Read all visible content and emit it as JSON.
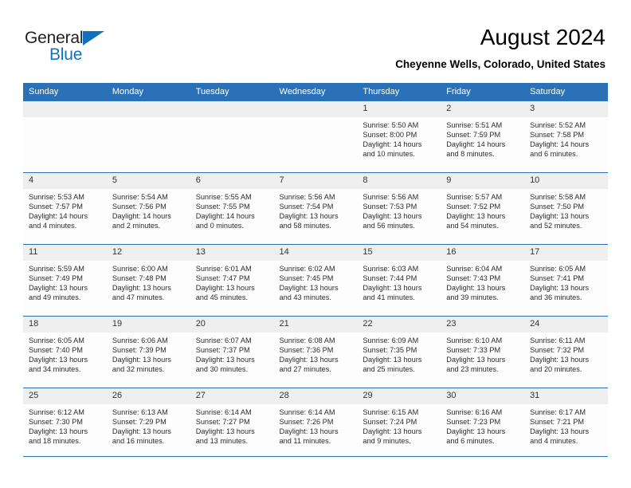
{
  "logo": {
    "top_text": "General",
    "bottom_text": "Blue",
    "triangle_color": "#1271bd"
  },
  "header": {
    "title": "August 2024",
    "subtitle": "Cheyenne Wells, Colorado, United States"
  },
  "theme": {
    "header_blue": "#2b71b8",
    "daynum_bg": "#efefef",
    "cell_bg": "#fdfdfd"
  },
  "calendar": {
    "weekday_headers": [
      "Sunday",
      "Monday",
      "Tuesday",
      "Wednesday",
      "Thursday",
      "Friday",
      "Saturday"
    ],
    "weeks": [
      [
        {
          "day": "",
          "lines": []
        },
        {
          "day": "",
          "lines": []
        },
        {
          "day": "",
          "lines": []
        },
        {
          "day": "",
          "lines": []
        },
        {
          "day": "1",
          "lines": [
            "Sunrise: 5:50 AM",
            "Sunset: 8:00 PM",
            "Daylight: 14 hours",
            "and 10 minutes."
          ]
        },
        {
          "day": "2",
          "lines": [
            "Sunrise: 5:51 AM",
            "Sunset: 7:59 PM",
            "Daylight: 14 hours",
            "and 8 minutes."
          ]
        },
        {
          "day": "3",
          "lines": [
            "Sunrise: 5:52 AM",
            "Sunset: 7:58 PM",
            "Daylight: 14 hours",
            "and 6 minutes."
          ]
        }
      ],
      [
        {
          "day": "4",
          "lines": [
            "Sunrise: 5:53 AM",
            "Sunset: 7:57 PM",
            "Daylight: 14 hours",
            "and 4 minutes."
          ]
        },
        {
          "day": "5",
          "lines": [
            "Sunrise: 5:54 AM",
            "Sunset: 7:56 PM",
            "Daylight: 14 hours",
            "and 2 minutes."
          ]
        },
        {
          "day": "6",
          "lines": [
            "Sunrise: 5:55 AM",
            "Sunset: 7:55 PM",
            "Daylight: 14 hours",
            "and 0 minutes."
          ]
        },
        {
          "day": "7",
          "lines": [
            "Sunrise: 5:56 AM",
            "Sunset: 7:54 PM",
            "Daylight: 13 hours",
            "and 58 minutes."
          ]
        },
        {
          "day": "8",
          "lines": [
            "Sunrise: 5:56 AM",
            "Sunset: 7:53 PM",
            "Daylight: 13 hours",
            "and 56 minutes."
          ]
        },
        {
          "day": "9",
          "lines": [
            "Sunrise: 5:57 AM",
            "Sunset: 7:52 PM",
            "Daylight: 13 hours",
            "and 54 minutes."
          ]
        },
        {
          "day": "10",
          "lines": [
            "Sunrise: 5:58 AM",
            "Sunset: 7:50 PM",
            "Daylight: 13 hours",
            "and 52 minutes."
          ]
        }
      ],
      [
        {
          "day": "11",
          "lines": [
            "Sunrise: 5:59 AM",
            "Sunset: 7:49 PM",
            "Daylight: 13 hours",
            "and 49 minutes."
          ]
        },
        {
          "day": "12",
          "lines": [
            "Sunrise: 6:00 AM",
            "Sunset: 7:48 PM",
            "Daylight: 13 hours",
            "and 47 minutes."
          ]
        },
        {
          "day": "13",
          "lines": [
            "Sunrise: 6:01 AM",
            "Sunset: 7:47 PM",
            "Daylight: 13 hours",
            "and 45 minutes."
          ]
        },
        {
          "day": "14",
          "lines": [
            "Sunrise: 6:02 AM",
            "Sunset: 7:45 PM",
            "Daylight: 13 hours",
            "and 43 minutes."
          ]
        },
        {
          "day": "15",
          "lines": [
            "Sunrise: 6:03 AM",
            "Sunset: 7:44 PM",
            "Daylight: 13 hours",
            "and 41 minutes."
          ]
        },
        {
          "day": "16",
          "lines": [
            "Sunrise: 6:04 AM",
            "Sunset: 7:43 PM",
            "Daylight: 13 hours",
            "and 39 minutes."
          ]
        },
        {
          "day": "17",
          "lines": [
            "Sunrise: 6:05 AM",
            "Sunset: 7:41 PM",
            "Daylight: 13 hours",
            "and 36 minutes."
          ]
        }
      ],
      [
        {
          "day": "18",
          "lines": [
            "Sunrise: 6:05 AM",
            "Sunset: 7:40 PM",
            "Daylight: 13 hours",
            "and 34 minutes."
          ]
        },
        {
          "day": "19",
          "lines": [
            "Sunrise: 6:06 AM",
            "Sunset: 7:39 PM",
            "Daylight: 13 hours",
            "and 32 minutes."
          ]
        },
        {
          "day": "20",
          "lines": [
            "Sunrise: 6:07 AM",
            "Sunset: 7:37 PM",
            "Daylight: 13 hours",
            "and 30 minutes."
          ]
        },
        {
          "day": "21",
          "lines": [
            "Sunrise: 6:08 AM",
            "Sunset: 7:36 PM",
            "Daylight: 13 hours",
            "and 27 minutes."
          ]
        },
        {
          "day": "22",
          "lines": [
            "Sunrise: 6:09 AM",
            "Sunset: 7:35 PM",
            "Daylight: 13 hours",
            "and 25 minutes."
          ]
        },
        {
          "day": "23",
          "lines": [
            "Sunrise: 6:10 AM",
            "Sunset: 7:33 PM",
            "Daylight: 13 hours",
            "and 23 minutes."
          ]
        },
        {
          "day": "24",
          "lines": [
            "Sunrise: 6:11 AM",
            "Sunset: 7:32 PM",
            "Daylight: 13 hours",
            "and 20 minutes."
          ]
        }
      ],
      [
        {
          "day": "25",
          "lines": [
            "Sunrise: 6:12 AM",
            "Sunset: 7:30 PM",
            "Daylight: 13 hours",
            "and 18 minutes."
          ]
        },
        {
          "day": "26",
          "lines": [
            "Sunrise: 6:13 AM",
            "Sunset: 7:29 PM",
            "Daylight: 13 hours",
            "and 16 minutes."
          ]
        },
        {
          "day": "27",
          "lines": [
            "Sunrise: 6:14 AM",
            "Sunset: 7:27 PM",
            "Daylight: 13 hours",
            "and 13 minutes."
          ]
        },
        {
          "day": "28",
          "lines": [
            "Sunrise: 6:14 AM",
            "Sunset: 7:26 PM",
            "Daylight: 13 hours",
            "and 11 minutes."
          ]
        },
        {
          "day": "29",
          "lines": [
            "Sunrise: 6:15 AM",
            "Sunset: 7:24 PM",
            "Daylight: 13 hours",
            "and 9 minutes."
          ]
        },
        {
          "day": "30",
          "lines": [
            "Sunrise: 6:16 AM",
            "Sunset: 7:23 PM",
            "Daylight: 13 hours",
            "and 6 minutes."
          ]
        },
        {
          "day": "31",
          "lines": [
            "Sunrise: 6:17 AM",
            "Sunset: 7:21 PM",
            "Daylight: 13 hours",
            "and 4 minutes."
          ]
        }
      ]
    ]
  }
}
